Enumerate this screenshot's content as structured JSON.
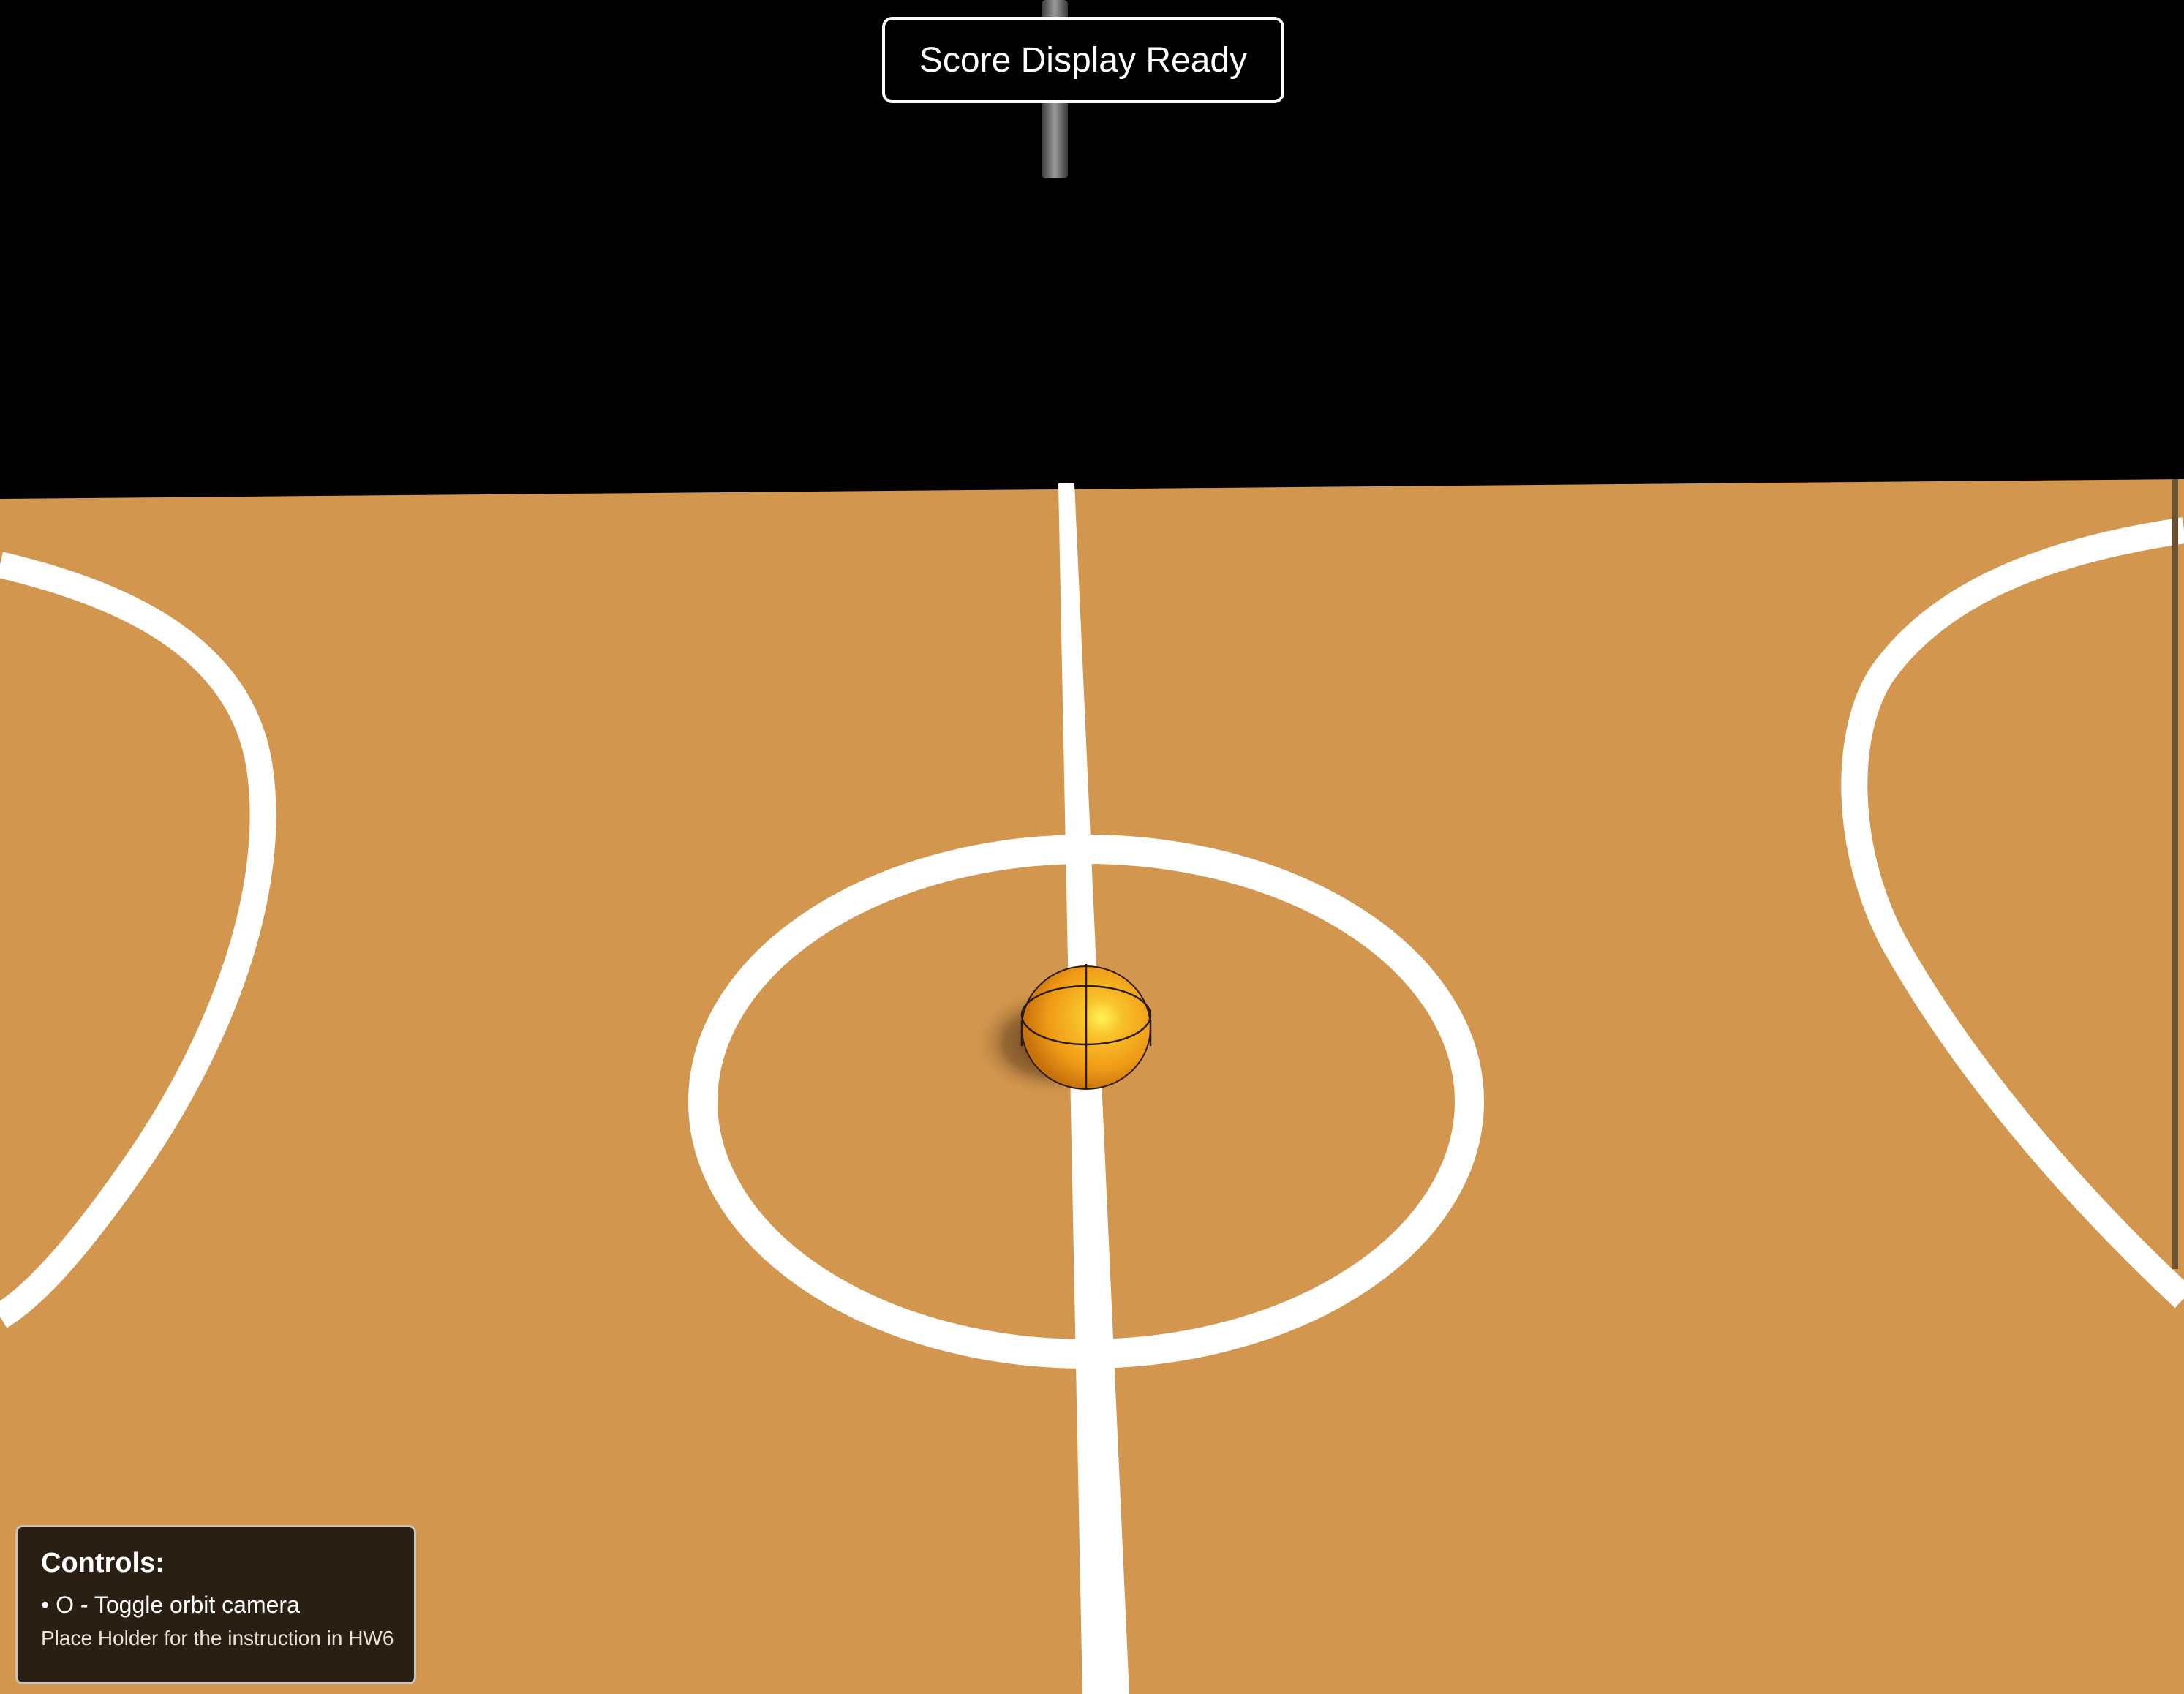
{
  "score_display": {
    "text": "Score Display Ready"
  },
  "controls": {
    "title": "Controls:",
    "items": [
      {
        "label": "• O - Toggle orbit camera"
      }
    ],
    "note": "Place Holder for the instruction in HW6"
  },
  "scene": {
    "background_color": "#000000",
    "court_color": "#d2964e",
    "line_color": "#ffffff",
    "ball_color": "#f5a21c",
    "pole_color": "#777777",
    "icons": [
      "basketball",
      "hoop-pole"
    ]
  }
}
